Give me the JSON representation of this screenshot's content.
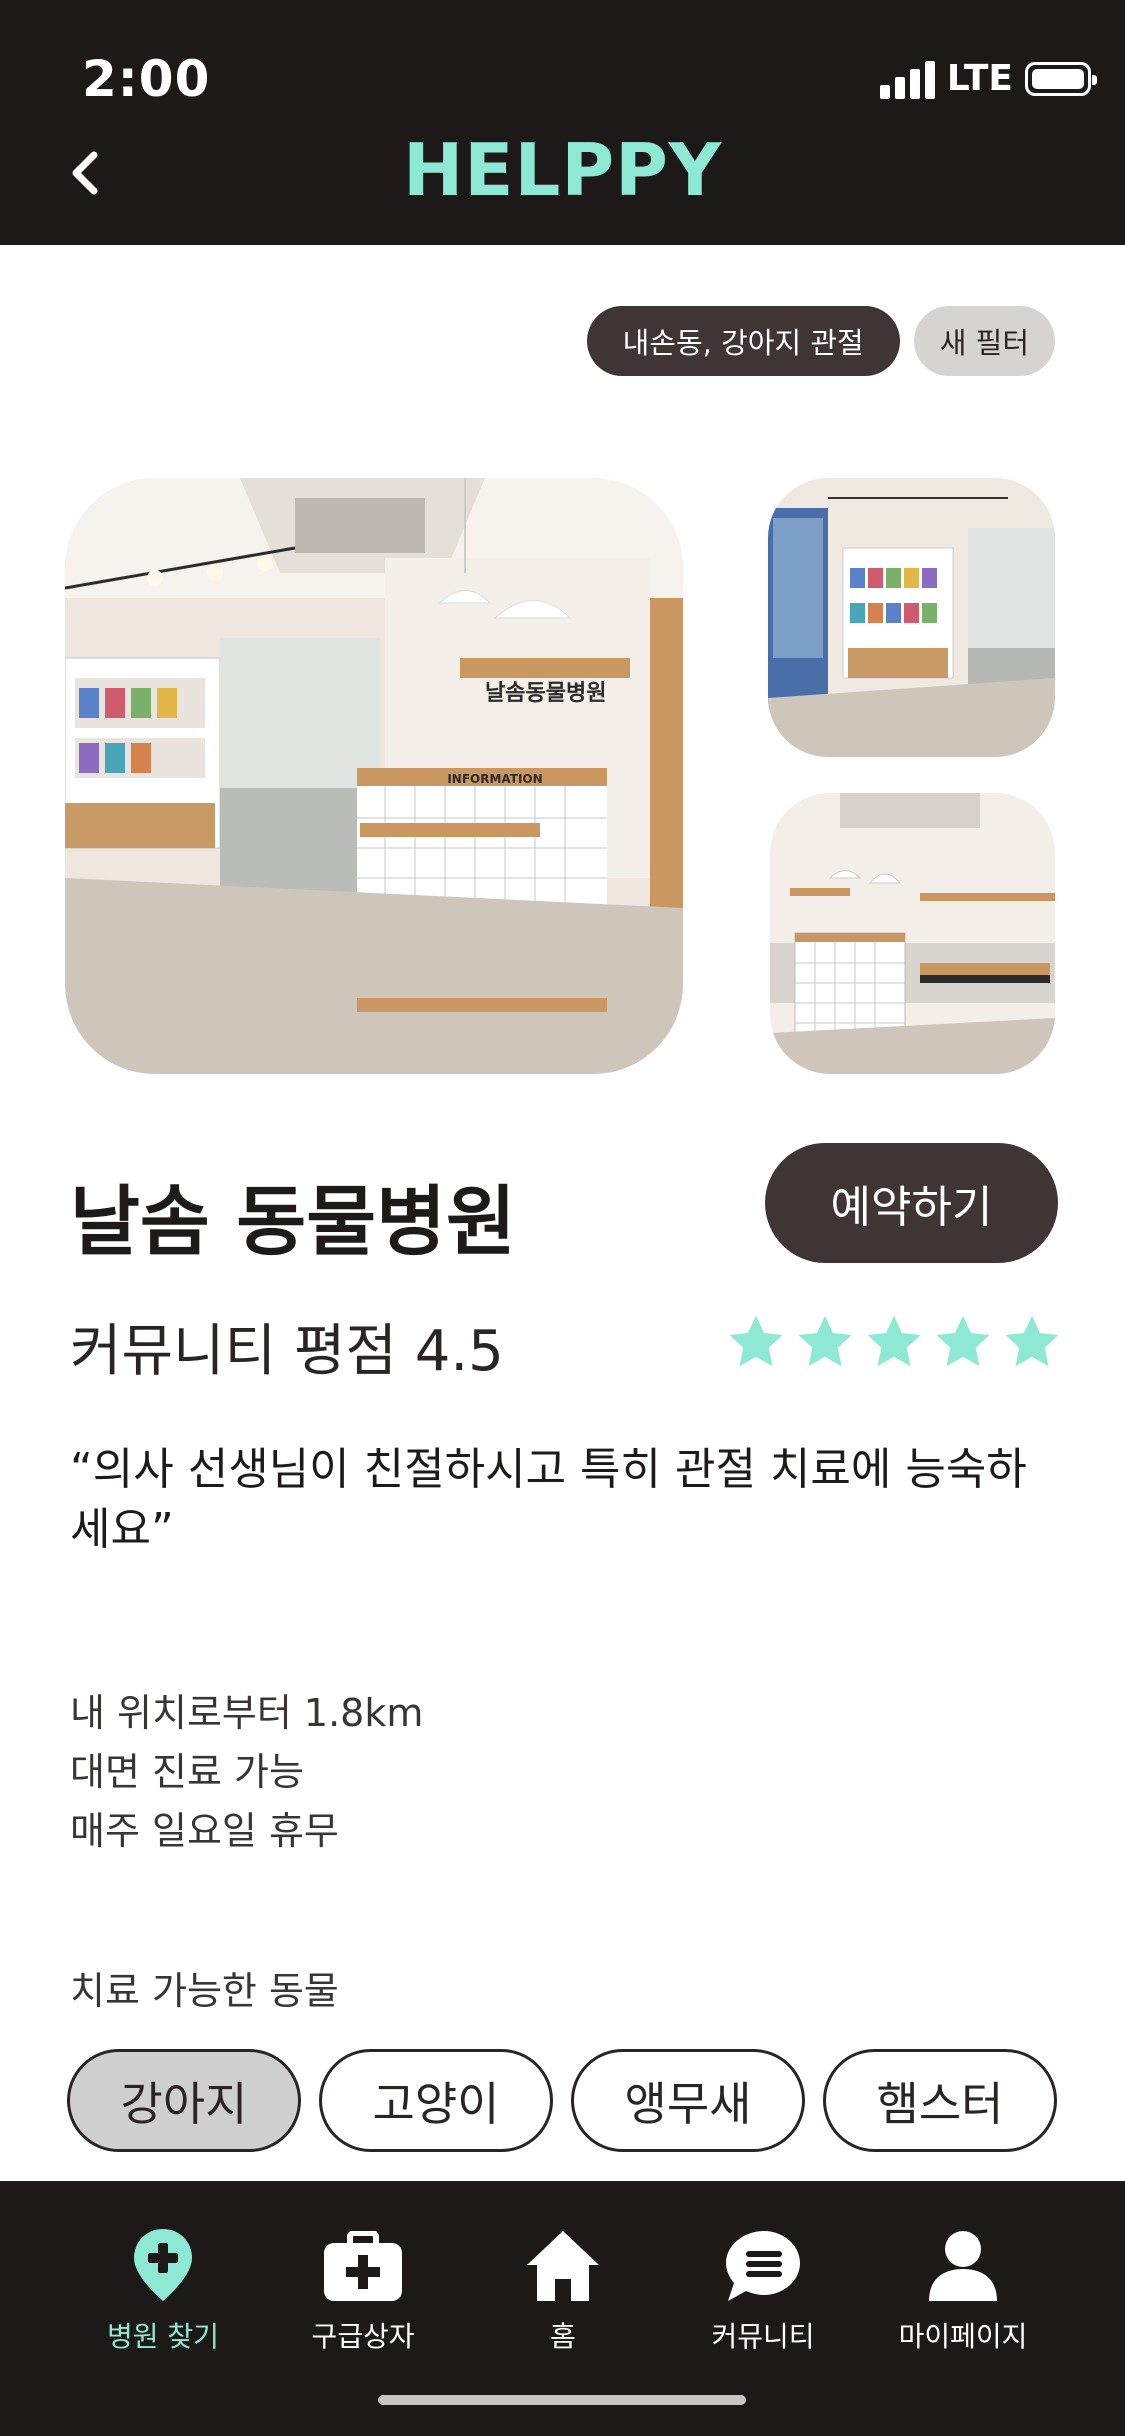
{
  "status_bar": {
    "time": "2:00",
    "network": "LTE"
  },
  "header": {
    "title": "HELPPY"
  },
  "filters": {
    "active_filter": "내손동, 강아지 관절",
    "new_filter": "새 필터"
  },
  "clinic": {
    "name": "날솜 동물병원",
    "reserve_label": "예약하기",
    "rating_text": "커뮤니티 평점 4.5",
    "rating_value": 4.5,
    "rating_max": 5,
    "review": "“의사 선생님이 친절하시고 특히 관절 치료에 능숙하세요”",
    "info": [
      "내 위치로부터 1.8km",
      "대면 진료 가능",
      "매주 일요일 휴무"
    ],
    "sign_text": "날솜동물병원",
    "desk_label": "INFORMATION"
  },
  "animals": {
    "label": "치료 가능한 동물",
    "items": [
      {
        "label": "강아지",
        "selected": true
      },
      {
        "label": "고양이",
        "selected": false
      },
      {
        "label": "앵무새",
        "selected": false
      },
      {
        "label": "햄스터",
        "selected": false
      }
    ]
  },
  "bottom_nav": [
    {
      "label": "병원 찾기",
      "icon": "location-pin-icon",
      "active": true
    },
    {
      "label": "구급상자",
      "icon": "first-aid-kit-icon",
      "active": false
    },
    {
      "label": "홈",
      "icon": "home-icon",
      "active": false
    },
    {
      "label": "커뮤니티",
      "icon": "chat-bubble-icon",
      "active": false
    },
    {
      "label": "마이페이지",
      "icon": "user-icon",
      "active": false
    }
  ],
  "colors": {
    "accent": "#8de9d4",
    "dark": "#1e1919",
    "button": "#3f3535",
    "chip_selected": "#cfcfcf"
  }
}
